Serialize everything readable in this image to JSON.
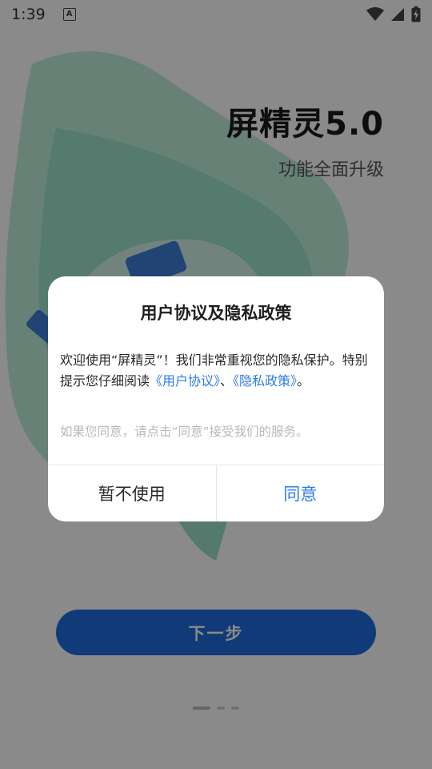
{
  "status_bar": {
    "time": "1:39",
    "notification_icon": "a-letter-icon",
    "icons": [
      "wifi-icon",
      "signal-icon",
      "battery-charging-icon"
    ]
  },
  "onboarding": {
    "title": "屏精灵5.0",
    "subtitle": "功能全面升级",
    "next_button_label": "下一步",
    "page_count": 3,
    "active_page": 1
  },
  "dialog": {
    "title": "用户协议及隐私政策",
    "body_intro": "欢迎使用“屏精灵”！我们非常重视您的隐私保护。特别提示您仔细阅读",
    "user_agreement_link": "《用户协议》",
    "separator": "、",
    "privacy_policy_link": "《隐私政策》",
    "body_end": "。",
    "hint": "如果您同意，请点击“同意”接受我们的服务。",
    "decline_label": "暂不使用",
    "agree_label": "同意"
  },
  "colors": {
    "accent": "#2f7be8",
    "button_blue": "#1f6bde",
    "illustration_green": "#3cc9a0"
  }
}
